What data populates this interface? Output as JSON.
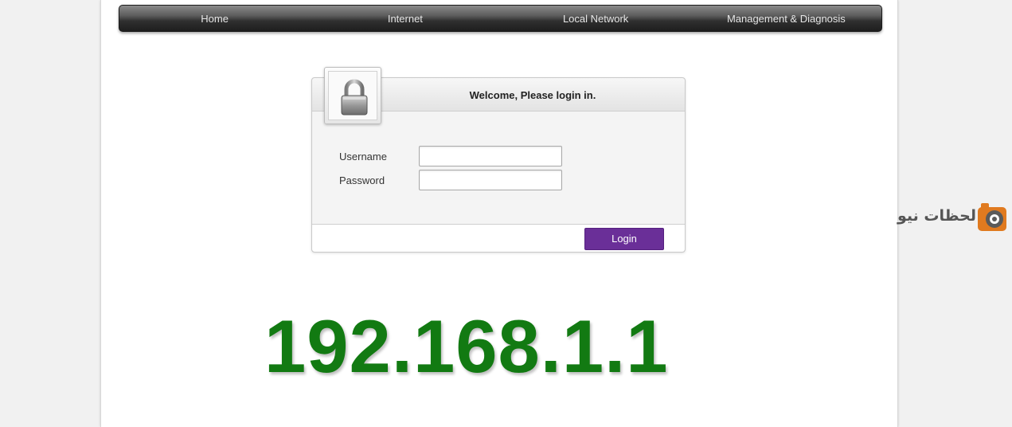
{
  "nav": {
    "items": [
      {
        "label": "Home"
      },
      {
        "label": "Internet"
      },
      {
        "label": "Local Network"
      },
      {
        "label": "Management & Diagnosis"
      }
    ]
  },
  "login": {
    "title": "Welcome, Please login in.",
    "icon": "padlock-icon",
    "username_label": "Username",
    "username_value": "",
    "password_label": "Password",
    "password_value": "",
    "button_label": "Login",
    "button_color": "#6a2f98"
  },
  "overlay": {
    "ip_address": "192.168.1.1",
    "ip_color": "#127a12"
  },
  "watermark": {
    "text": "لحظات نيوز",
    "logo": "camera-logo-icon"
  }
}
